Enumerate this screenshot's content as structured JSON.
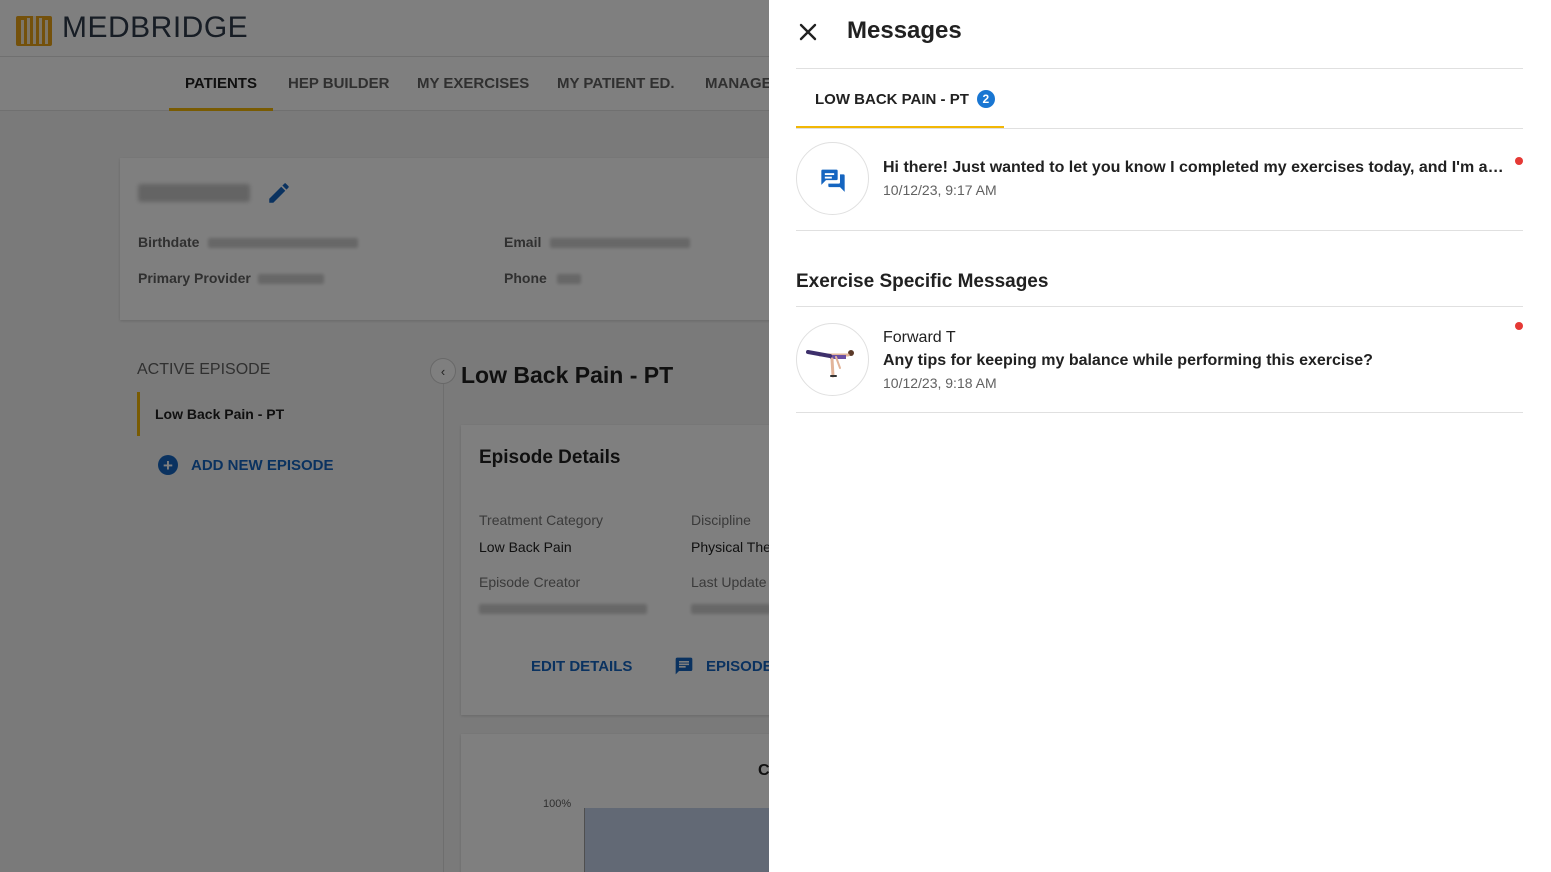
{
  "app": {
    "brand": "MEDBRIDGE",
    "nav": [
      "PATIENTS",
      "HEP BUILDER",
      "MY EXERCISES",
      "MY PATIENT ED.",
      "MANAGE"
    ],
    "patient": {
      "birthdate_label": "Birthdate",
      "primary_provider_label": "Primary Provider",
      "email_label": "Email",
      "phone_label": "Phone"
    },
    "active_episode_title": "ACTIVE EPISODE",
    "episode_item": "Low Back Pain - PT",
    "add_new_episode": "ADD NEW EPISODE",
    "episode_heading": "Low Back Pain - PT",
    "details": {
      "title": "Episode Details",
      "treatment_category_label": "Treatment Category",
      "treatment_category_value": "Low Back Pain",
      "discipline_label": "Discipline",
      "discipline_value": "Physical The",
      "episode_creator_label": "Episode Creator",
      "last_updated_label": "Last Update",
      "edit_details": "EDIT DETAILS",
      "episode_messages": "EPISODE"
    },
    "chart": {
      "tick_label": "100%",
      "title_fragment": "C"
    }
  },
  "drawer": {
    "title": "Messages",
    "tab": {
      "label": "LOW BACK PAIN - PT",
      "badge": "2"
    },
    "general_message": {
      "body": "Hi there! Just wanted to let you know I completed my exercises today, and I'm already feeling stronger!",
      "time": "10/12/23, 9:17 AM",
      "unread": true
    },
    "section_heading": "Exercise Specific Messages",
    "exercise_message": {
      "exercise": "Forward T",
      "body": "Any tips for keeping my balance while performing this exercise?",
      "time": "10/12/23, 9:18 AM",
      "unread": true
    }
  },
  "colors": {
    "accent": "#f2b705",
    "link": "#1565c0",
    "badge": "#1976d2",
    "unread": "#e53935",
    "overlay": "rgba(0,0,0,0.5)"
  }
}
